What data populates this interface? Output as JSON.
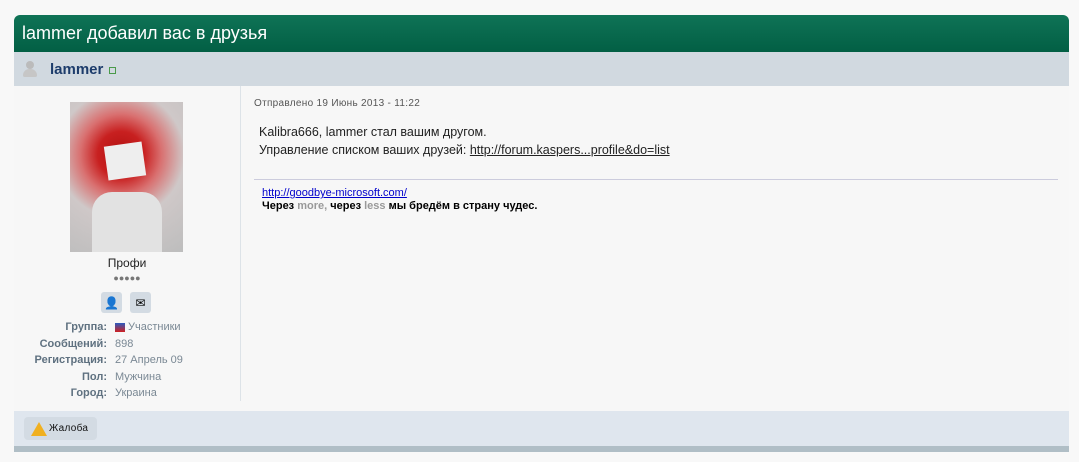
{
  "header": {
    "title": "lammer добавил вас в друзья"
  },
  "author": {
    "name": "lammer",
    "rank": "Профи",
    "pips": "●●●●●",
    "info": [
      {
        "k": "Группа:",
        "v": "Участники"
      },
      {
        "k": "Сообщений:",
        "v": "898"
      },
      {
        "k": "Регистрация:",
        "v": "27 Апрель 09"
      },
      {
        "k": "Пол:",
        "v": "Мужчина"
      },
      {
        "k": "Город:",
        "v": "Украина"
      }
    ]
  },
  "post": {
    "date": "Отправлено 19 Июнь 2013 - 11:22",
    "line1": "Kalibra666, lammer стал вашим другом.",
    "line2": "Управление списком ваших друзей: ",
    "link": "http://forum.kaspers...profile&do=list"
  },
  "signature": {
    "link": "http://goodbye-microsoft.com/",
    "p1": "Через ",
    "more": "more,",
    "p2": " через ",
    "less": "less",
    "p3": " мы бредём в страну чудес."
  },
  "footer": {
    "report": "Жалоба"
  }
}
